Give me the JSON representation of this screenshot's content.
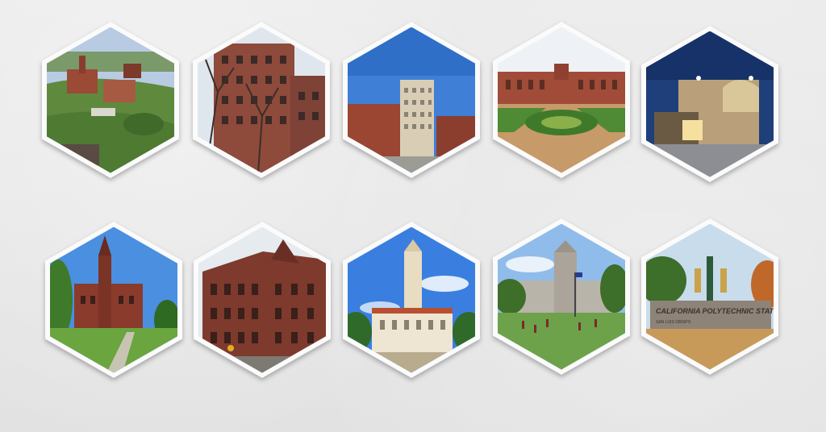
{
  "collage": {
    "tiles": [
      {
        "id": "campus-hillside-aerial"
      },
      {
        "id": "brick-tower-with-bare-trees"
      },
      {
        "id": "city-campus-high-rise"
      },
      {
        "id": "courtyard-with-formal-garden"
      },
      {
        "id": "modern-building-at-dusk"
      },
      {
        "id": "gothic-clock-tower-lawn"
      },
      {
        "id": "red-brick-victorian-hall"
      },
      {
        "id": "main-tower-blue-sky"
      },
      {
        "id": "quad-with-students"
      },
      {
        "id": "stone-entrance-sign"
      }
    ],
    "sign_text": {
      "line1": "CALIFORNIA POLYTECHNIC STATE",
      "line2": "SAN LUIS OBISPO"
    },
    "colors": {
      "background": "#e6e6e6",
      "frame": "#fbfbfb",
      "sky_blue": "#3f7fd6",
      "brick": "#8a3b2c"
    }
  }
}
